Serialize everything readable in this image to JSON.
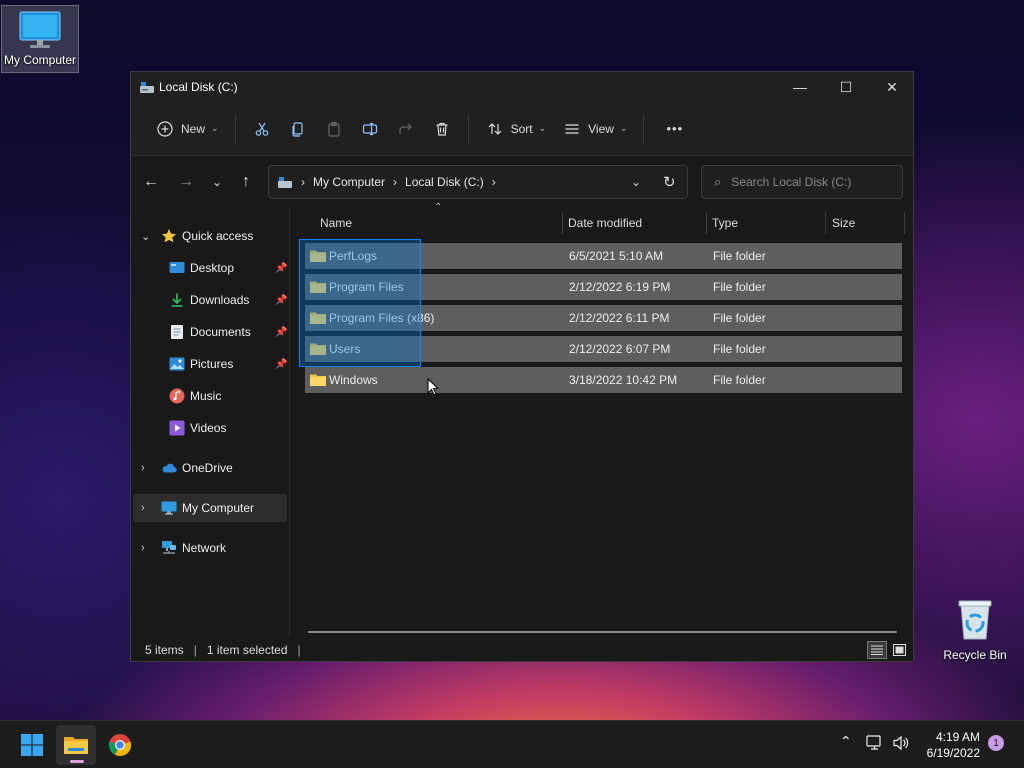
{
  "desktop": {
    "icons": [
      {
        "label": "My Computer"
      },
      {
        "label": "Recycle Bin"
      }
    ]
  },
  "window": {
    "title": "Local Disk (C:)",
    "controls": {
      "minimize": "—",
      "maximize": "☐",
      "close": "✕"
    }
  },
  "commandbar": {
    "new_label": "New",
    "sort_label": "Sort",
    "view_label": "View",
    "more_label": "•••"
  },
  "addressbar": {
    "crumbs": [
      "My Computer",
      "Local Disk (C:)"
    ]
  },
  "search": {
    "placeholder": "Search Local Disk (C:)"
  },
  "navpane": {
    "quick_access": "Quick access",
    "items": [
      "Desktop",
      "Downloads",
      "Documents",
      "Pictures",
      "Music",
      "Videos"
    ],
    "onedrive": "OneDrive",
    "mycomputer": "My Computer",
    "network": "Network"
  },
  "filelist": {
    "columns": {
      "name": "Name",
      "date": "Date modified",
      "type": "Type",
      "size": "Size"
    },
    "rows": [
      {
        "name": "PerfLogs",
        "date": "6/5/2021 5:10 AM",
        "type": "File folder"
      },
      {
        "name": "Program Files",
        "date": "2/12/2022 6:19 PM",
        "type": "File folder"
      },
      {
        "name": "Program Files (x86)",
        "date": "2/12/2022 6:11 PM",
        "type": "File folder"
      },
      {
        "name": "Users",
        "date": "2/12/2022 6:07 PM",
        "type": "File folder"
      },
      {
        "name": "Windows",
        "date": "3/18/2022 10:42 PM",
        "type": "File folder"
      }
    ]
  },
  "status": {
    "items": "5 items",
    "selected": "1 item selected"
  },
  "taskbar": {
    "time": "4:19 AM",
    "date": "6/19/2022",
    "notification_count": "1"
  },
  "colors": {
    "accent": "#0a84ff",
    "folder": "#f4c542"
  }
}
